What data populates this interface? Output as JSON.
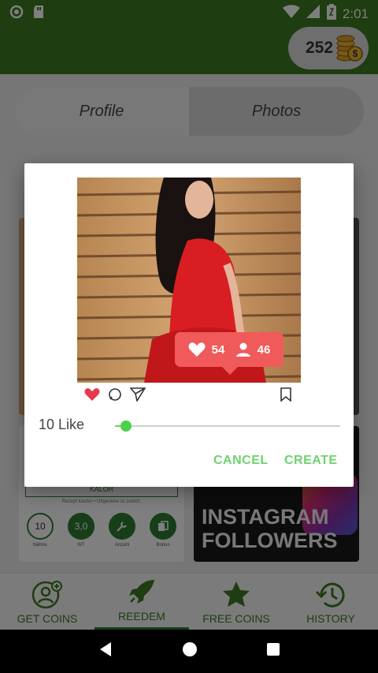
{
  "status_bar": {
    "time": "2:01",
    "battery_level": "Z"
  },
  "app_bar": {
    "coin_count": "252"
  },
  "tabs": [
    {
      "label": "Profile"
    },
    {
      "label": "Photos"
    }
  ],
  "background_cards": {
    "kalor_label": "KALOR",
    "caption": "Rezept kaufen • Uhgeniere ist zuletzt.",
    "badges": [
      {
        "value": "10",
        "label": "Nährw."
      },
      {
        "value": "3,0",
        "label": "WT"
      },
      {
        "value": "",
        "label": "Anzahl"
      },
      {
        "value": "",
        "label": "Bonus"
      }
    ],
    "promo_line1": "INSTAGRAM",
    "promo_line2": "FOLLOWERS"
  },
  "dialog": {
    "likes": "54",
    "followers": "46",
    "like_label": "10 Like",
    "slider_fraction": 0.05,
    "cancel_label": "CANCEL",
    "create_label": "CREATE"
  },
  "bottom_nav": [
    {
      "label": "GET COINS",
      "icon": "add-user-icon"
    },
    {
      "label": "REEDEM",
      "icon": "rocket-icon"
    },
    {
      "label": "FREE COINS",
      "icon": "star-icon"
    },
    {
      "label": "HISTORY",
      "icon": "history-icon"
    }
  ],
  "colors": {
    "primary": "#3d7a21",
    "accent": "#6dd36d",
    "like_badge": "#f05a5a"
  }
}
